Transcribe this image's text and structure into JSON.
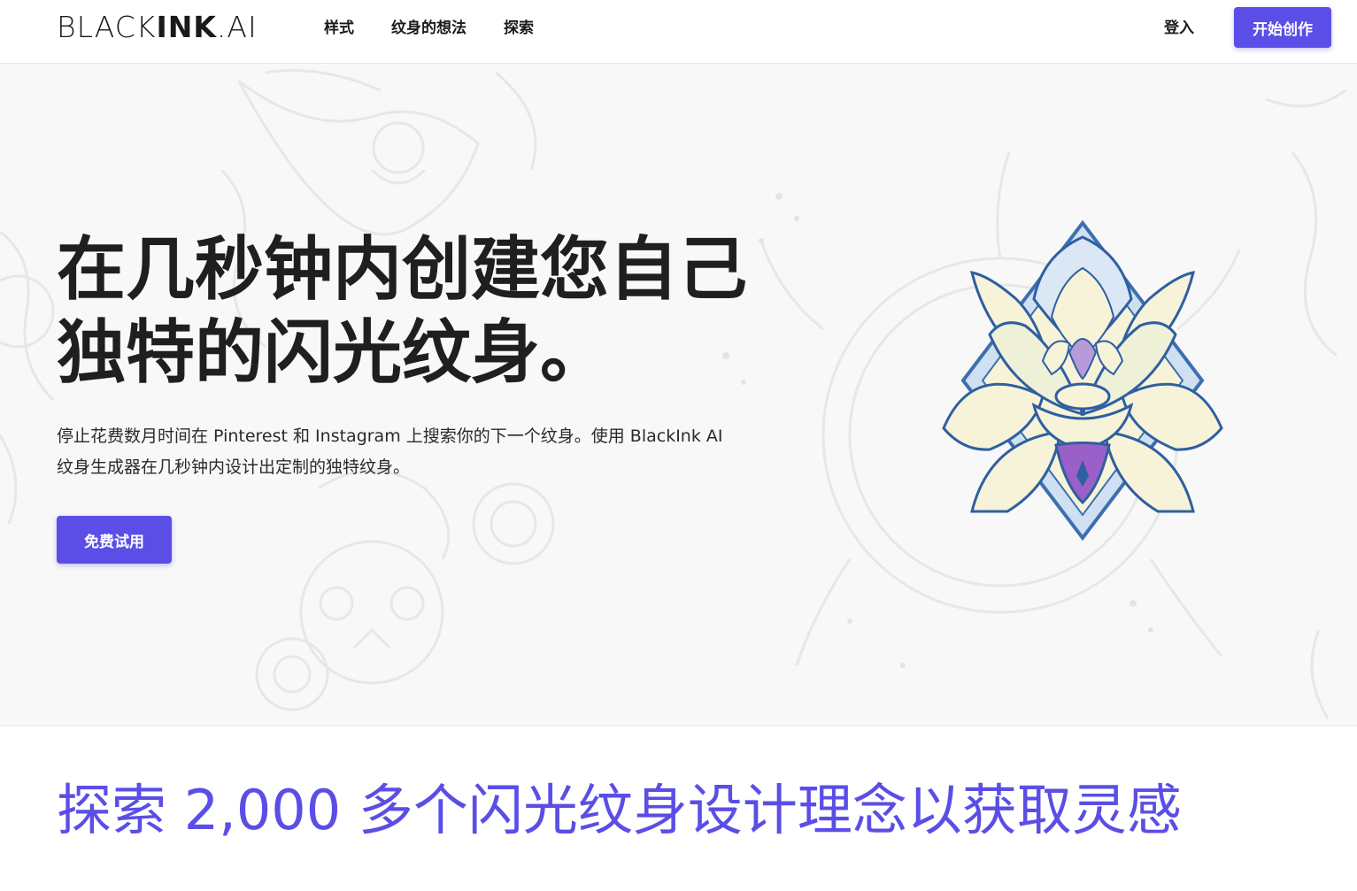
{
  "header": {
    "logo_light": "BLACK",
    "logo_bold": "INK",
    "logo_suffix": ".AI",
    "nav": [
      {
        "label": "样式"
      },
      {
        "label": "纹身的想法"
      },
      {
        "label": "探索"
      }
    ],
    "login_label": "登入",
    "cta_label": "开始创作"
  },
  "hero": {
    "title_line1": "在几秒钟内创建您自己",
    "title_line2": "独特的闪光纹身。",
    "description_line1": "停止花费数月时间在 Pinterest 和 Instagram 上搜索你的下一个纹身。使用 BlackInk AI",
    "description_line2": "纹身生成器在几秒钟内设计出定制的独特纹身。",
    "cta_label": "免费试用",
    "image_icon": "lotus-tattoo-illustration"
  },
  "explore": {
    "title": "探索 2,000 多个闪光纹身设计理念以获取灵感"
  },
  "colors": {
    "accent": "#5a4ee6",
    "text": "#1f1f1f",
    "hero_bg": "#f8f8f8",
    "lotus_blue": "#3d6fb0",
    "lotus_cream": "#f6f3d9",
    "lotus_purple": "#9b5fc9"
  }
}
